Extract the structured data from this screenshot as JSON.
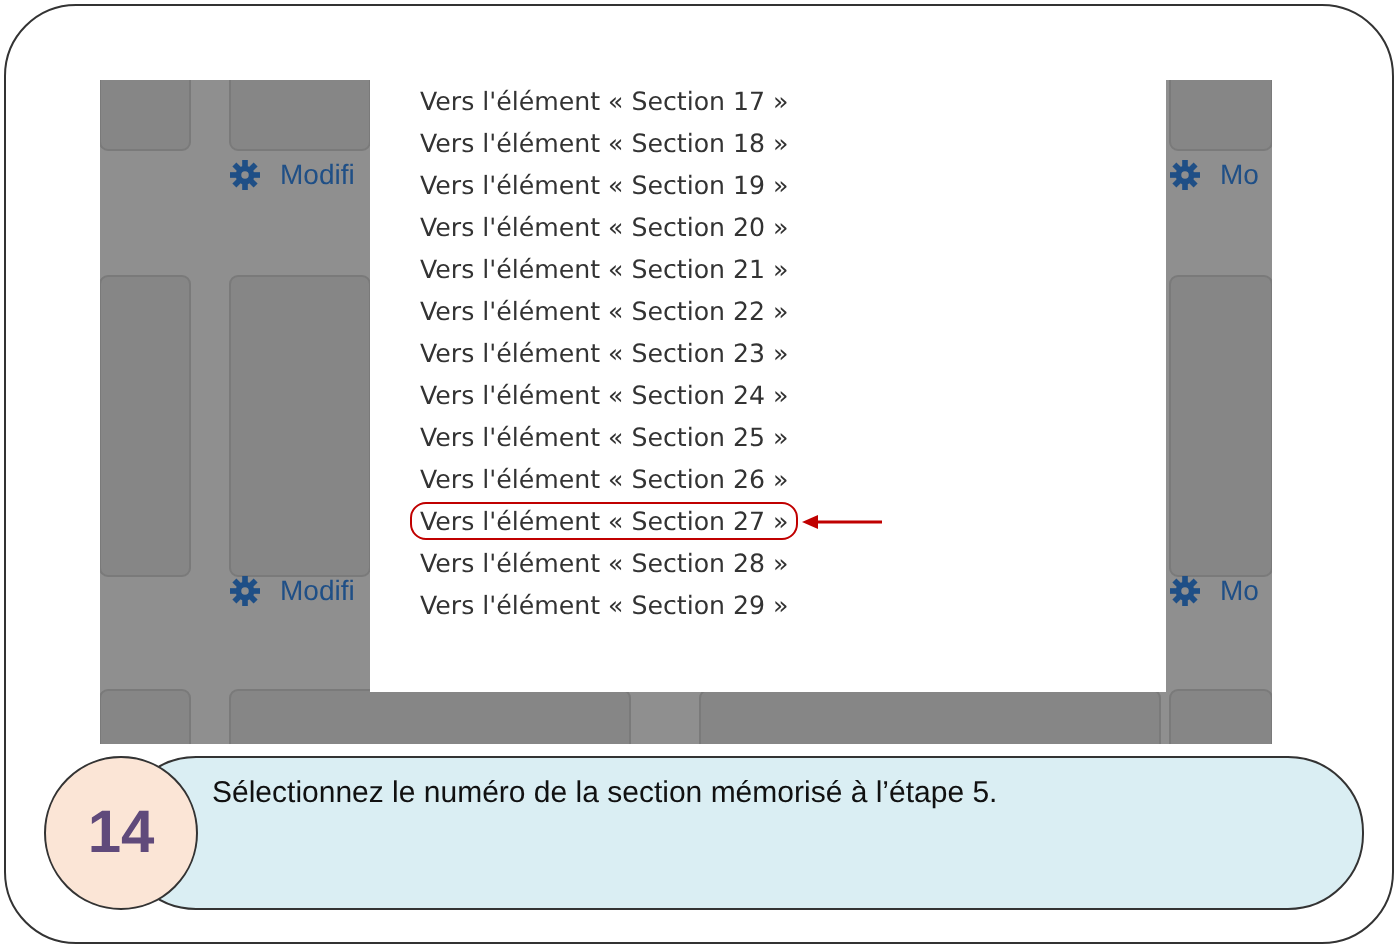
{
  "screenshot": {
    "links": [
      {
        "label": "Modifi"
      },
      {
        "label": "Modifi"
      },
      {
        "label": "Mo"
      },
      {
        "label": "Mo"
      }
    ],
    "menu": {
      "items": [
        {
          "label": "Vers l'élément « Section 17 »",
          "highlighted": false
        },
        {
          "label": "Vers l'élément « Section 18 »",
          "highlighted": false
        },
        {
          "label": "Vers l'élément « Section 19 »",
          "highlighted": false
        },
        {
          "label": "Vers l'élément « Section 20 »",
          "highlighted": false
        },
        {
          "label": "Vers l'élément « Section 21 »",
          "highlighted": false
        },
        {
          "label": "Vers l'élément « Section 22 »",
          "highlighted": false
        },
        {
          "label": "Vers l'élément « Section 23 »",
          "highlighted": false
        },
        {
          "label": "Vers l'élément « Section 24 »",
          "highlighted": false
        },
        {
          "label": "Vers l'élément « Section 25 »",
          "highlighted": false
        },
        {
          "label": "Vers l'élément « Section 26 »",
          "highlighted": false
        },
        {
          "label": "Vers l'élément « Section 27 »",
          "highlighted": true
        },
        {
          "label": "Vers l'élément « Section 28 »",
          "highlighted": false
        },
        {
          "label": "Vers l'élément « Section 29 »",
          "highlighted": false
        }
      ]
    }
  },
  "step": {
    "number": "14",
    "instruction": "Sélectionnez le numéro de la section mémorisé à l’étape 5."
  }
}
